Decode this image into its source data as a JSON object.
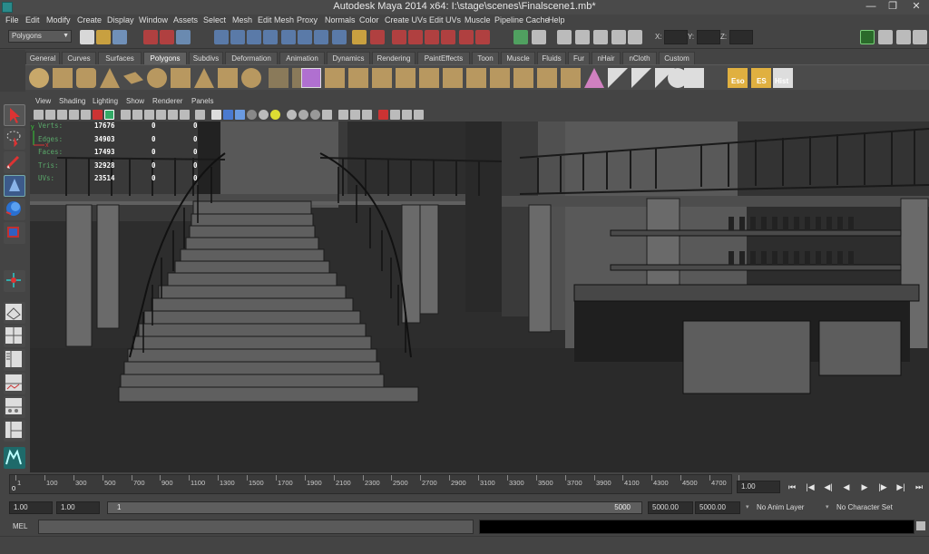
{
  "window": {
    "title": "Autodesk Maya 2014 x64: I:\\stage\\scenes\\Finalscene1.mb*"
  },
  "menus": [
    "File",
    "Edit",
    "Modify",
    "Create",
    "Display",
    "Window",
    "Assets",
    "Select",
    "Mesh",
    "Edit Mesh",
    "Proxy",
    "Normals",
    "Color",
    "Create UVs",
    "Edit UVs",
    "Muscle",
    "Pipeline Cache",
    "Help"
  ],
  "status": {
    "mode": "Polygons",
    "x_label": "X:",
    "y_label": "Y:",
    "z_label": "Z:"
  },
  "shelf": {
    "tabs": [
      "General",
      "Curves",
      "Surfaces",
      "Polygons",
      "Subdivs",
      "Deformation",
      "Animation",
      "Dynamics",
      "Rendering",
      "PaintEffects",
      "Toon",
      "Muscle",
      "Fluids",
      "Fur",
      "nHair",
      "nCloth",
      "Custom"
    ],
    "active_tab": "Polygons",
    "text_buttons": [
      "Eso",
      "ES",
      "Hist"
    ]
  },
  "panel": {
    "menus": [
      "View",
      "Shading",
      "Lighting",
      "Show",
      "Renderer",
      "Panels"
    ]
  },
  "hud": [
    {
      "label": "Verts:",
      "v1": "17676",
      "v2": "0",
      "v3": "0"
    },
    {
      "label": "Edges:",
      "v1": "34903",
      "v2": "0",
      "v3": "0"
    },
    {
      "label": "Faces:",
      "v1": "17493",
      "v2": "0",
      "v3": "0"
    },
    {
      "label": "Tris:",
      "v1": "32928",
      "v2": "0",
      "v3": "0"
    },
    {
      "label": "UVs:",
      "v1": "23514",
      "v2": "0",
      "v3": "0"
    }
  ],
  "timeline": {
    "ticks": [
      "1",
      "100",
      "300",
      "500",
      "700",
      "900",
      "1100",
      "1300",
      "1500",
      "1700",
      "1900",
      "2100",
      "2300",
      "2500",
      "2700",
      "2900",
      "3100",
      "3300",
      "3500",
      "3700",
      "3900",
      "4100",
      "4300",
      "4500",
      "4700",
      "4900"
    ],
    "current_frame": "1.00",
    "playhead_label": "0"
  },
  "range": {
    "start": "1.00",
    "playback_start": "1.00",
    "slider_start": "1",
    "slider_end": "5000",
    "playback_end": "5000.00",
    "end": "5000.00",
    "anim_layer": "No Anim Layer",
    "character_set": "No Character Set"
  },
  "command": {
    "lang": "MEL"
  },
  "colors": {
    "viewport_bg": "#2b2b2b",
    "hud_label": "#5aa86a",
    "active_tab": "#5f5f5f"
  }
}
